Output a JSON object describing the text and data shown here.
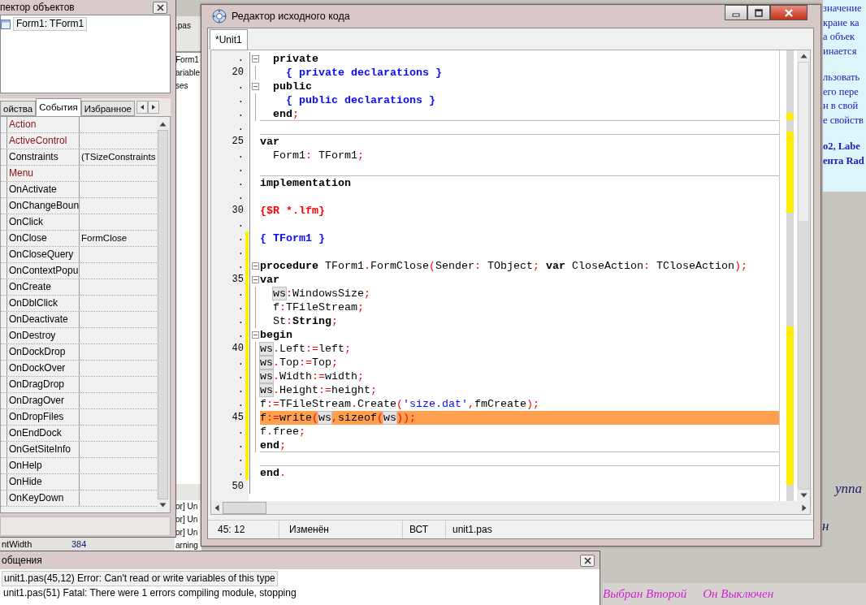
{
  "desktop": {
    "document_paragraphs": [
      {
        "bold": false,
        "lines": [
          "значение",
          "кране ка",
          "а объек",
          "инается"
        ]
      },
      {
        "bold": false,
        "lines": [
          "льзовать",
          "его пере",
          "н в свой",
          "е свойств"
        ]
      },
      {
        "bold": true,
        "lines": [
          "о2, Labe",
          "ента Rad"
        ]
      }
    ],
    "ide_fragments": [
      ".pas",
      "Form1",
      "ariable",
      "ses"
    ],
    "message_fragments": [
      "or] Un",
      "or] Un",
      "or] Un",
      "arning"
    ],
    "property_fragment": {
      "name": "ntWidth",
      "value": "384"
    },
    "group_labels": [
      "уппа",
      "н"
    ],
    "radio_status": [
      "Выбран Второй",
      "Он Выключен"
    ]
  },
  "object_inspector": {
    "title": "пектор объектов",
    "tree": [
      {
        "label": "Form1: TForm1"
      }
    ],
    "tabs": [
      {
        "label": "ойства",
        "selected": false
      },
      {
        "label": "События",
        "selected": true
      },
      {
        "label": "Избранное",
        "selected": false
      }
    ],
    "rows": [
      {
        "name": "Action",
        "kind": "reference"
      },
      {
        "name": "ActiveControl",
        "kind": "reference"
      },
      {
        "name": "Constraints",
        "value": "(TSizeConstraints",
        "kind": "plain"
      },
      {
        "name": "Menu",
        "kind": "reference"
      },
      {
        "name": "OnActivate",
        "kind": "plain"
      },
      {
        "name": "OnChangeBoun",
        "kind": "plain"
      },
      {
        "name": "OnClick",
        "kind": "plain"
      },
      {
        "name": "OnClose",
        "value": "FormClose",
        "kind": "plain"
      },
      {
        "name": "OnCloseQuery",
        "kind": "plain"
      },
      {
        "name": "OnContextPopu",
        "kind": "plain"
      },
      {
        "name": "OnCreate",
        "kind": "plain"
      },
      {
        "name": "OnDblClick",
        "kind": "plain"
      },
      {
        "name": "OnDeactivate",
        "kind": "plain"
      },
      {
        "name": "OnDestroy",
        "kind": "plain"
      },
      {
        "name": "OnDockDrop",
        "kind": "plain"
      },
      {
        "name": "OnDockOver",
        "kind": "plain"
      },
      {
        "name": "OnDragDrop",
        "kind": "plain"
      },
      {
        "name": "OnDragOver",
        "kind": "plain"
      },
      {
        "name": "OnDropFiles",
        "kind": "plain"
      },
      {
        "name": "OnEndDock",
        "kind": "plain"
      },
      {
        "name": "OnGetSiteInfo",
        "kind": "plain"
      },
      {
        "name": "OnHelp",
        "kind": "plain"
      },
      {
        "name": "OnHide",
        "kind": "plain"
      },
      {
        "name": "OnKeyDown",
        "kind": "plain"
      }
    ]
  },
  "source_editor": {
    "title": "Редактор исходного кода",
    "tabs": [
      {
        "label": "*Unit1",
        "selected": true
      }
    ],
    "lines": [
      {
        "gutter": ".",
        "fold_toggle": true,
        "indented": true,
        "modified": false,
        "error": false,
        "rule_below": false,
        "tokens": [
          {
            "kind": "kw",
            "text": "private"
          }
        ]
      },
      {
        "gutter": "20",
        "fold_toggle": false,
        "in_fold": true,
        "indented": true,
        "modified": false,
        "error": false,
        "rule_below": false,
        "tokens": [
          {
            "kind": "comment",
            "text": "  { private declarations }"
          }
        ]
      },
      {
        "gutter": ".",
        "fold_toggle": true,
        "indented": true,
        "modified": false,
        "error": false,
        "rule_below": false,
        "tokens": [
          {
            "kind": "kw",
            "text": "public"
          }
        ]
      },
      {
        "gutter": ".",
        "fold_toggle": false,
        "in_fold": true,
        "indented": true,
        "modified": false,
        "error": false,
        "rule_below": false,
        "tokens": [
          {
            "kind": "comment",
            "text": "  { public declarations }"
          }
        ]
      },
      {
        "gutter": ".",
        "fold_toggle": false,
        "in_fold": true,
        "indented": true,
        "modified": false,
        "error": false,
        "rule_below": true,
        "tokens": [
          {
            "kind": "kw",
            "text": "end"
          },
          {
            "kind": "sym",
            "text": ";"
          }
        ]
      },
      {
        "gutter": ".",
        "fold_toggle": false,
        "in_fold": false,
        "modified": false,
        "error": false,
        "rule_below": true
      },
      {
        "gutter": "25",
        "fold_toggle": false,
        "in_fold": false,
        "indented": false,
        "modified": false,
        "error": false,
        "rule_below": false,
        "tokens": [
          {
            "kind": "kw",
            "text": "var"
          }
        ]
      },
      {
        "gutter": ".",
        "fold_toggle": false,
        "in_fold": false,
        "indented": true,
        "modified": false,
        "error": false,
        "rule_below": false,
        "tokens": [
          {
            "kind": "text",
            "text": "Form1"
          },
          {
            "kind": "sym",
            "text": ":"
          },
          {
            "kind": "text",
            "text": " TForm1"
          },
          {
            "kind": "sym",
            "text": ";"
          }
        ]
      },
      {
        "gutter": ".",
        "fold_toggle": false,
        "in_fold": false,
        "modified": false,
        "error": false,
        "rule_below": true
      },
      {
        "gutter": ".",
        "fold_toggle": false,
        "in_fold": false,
        "indented": false,
        "modified": false,
        "error": false,
        "rule_below": false,
        "tokens": [
          {
            "kind": "kw",
            "text": "implementation"
          }
        ]
      },
      {
        "gutter": ".",
        "fold_toggle": false,
        "in_fold": false,
        "modified": false,
        "error": false,
        "rule_below": false
      },
      {
        "gutter": "30",
        "fold_toggle": false,
        "in_fold": false,
        "indented": false,
        "modified": false,
        "error": false,
        "rule_below": false,
        "tokens": [
          {
            "kind": "directive",
            "text": "{$R *.lfm}"
          }
        ]
      },
      {
        "gutter": ".",
        "fold_toggle": false,
        "in_fold": false,
        "modified": false,
        "error": false,
        "rule_below": false
      },
      {
        "gutter": ".",
        "fold_toggle": false,
        "in_fold": false,
        "indented": false,
        "modified": true,
        "error": false,
        "rule_below": false,
        "tokens": [
          {
            "kind": "comment",
            "text": "{ TForm1 }"
          }
        ]
      },
      {
        "gutter": ".",
        "fold_toggle": false,
        "in_fold": false,
        "modified": true,
        "error": false,
        "rule_below": false
      },
      {
        "gutter": ".",
        "fold_toggle": true,
        "indented": false,
        "modified": true,
        "error": false,
        "rule_below": false,
        "tokens": [
          {
            "kind": "kw",
            "text": "procedure"
          },
          {
            "kind": "text",
            "text": " TForm1"
          },
          {
            "kind": "sym",
            "text": "."
          },
          {
            "kind": "text",
            "text": "FormClose"
          },
          {
            "kind": "sym",
            "text": "("
          },
          {
            "kind": "text",
            "text": "Sender"
          },
          {
            "kind": "sym",
            "text": ":"
          },
          {
            "kind": "text",
            "text": " TObject"
          },
          {
            "kind": "sym",
            "text": "; "
          },
          {
            "kind": "kw",
            "text": "var"
          },
          {
            "kind": "text",
            "text": " CloseAction"
          },
          {
            "kind": "sym",
            "text": ":"
          },
          {
            "kind": "text",
            "text": " TCloseAction"
          },
          {
            "kind": "sym",
            "text": ");"
          }
        ]
      },
      {
        "gutter": "35",
        "fold_toggle": true,
        "indented": false,
        "modified": true,
        "error": false,
        "rule_below": false,
        "tokens": [
          {
            "kind": "kw",
            "text": "var"
          }
        ]
      },
      {
        "gutter": ".",
        "fold_toggle": false,
        "in_fold": true,
        "indented": true,
        "modified": true,
        "error": false,
        "rule_below": false,
        "tokens": [
          {
            "kind": "match",
            "text": "ws"
          },
          {
            "kind": "sym",
            "text": ":"
          },
          {
            "kind": "text",
            "text": "WindowsSize"
          },
          {
            "kind": "sym",
            "text": ";"
          }
        ]
      },
      {
        "gutter": ".",
        "fold_toggle": false,
        "in_fold": true,
        "indented": true,
        "modified": true,
        "error": false,
        "rule_below": false,
        "tokens": [
          {
            "kind": "text",
            "text": "f"
          },
          {
            "kind": "sym",
            "text": ":"
          },
          {
            "kind": "text",
            "text": "TFileStream"
          },
          {
            "kind": "sym",
            "text": ";"
          }
        ]
      },
      {
        "gutter": ".",
        "fold_toggle": false,
        "in_fold": true,
        "indented": true,
        "modified": true,
        "error": false,
        "rule_below": false,
        "tokens": [
          {
            "kind": "text",
            "text": "St"
          },
          {
            "kind": "sym",
            "text": ":"
          },
          {
            "kind": "kw",
            "text": "String"
          },
          {
            "kind": "sym",
            "text": ";"
          }
        ]
      },
      {
        "gutter": ".",
        "fold_toggle": true,
        "indented": false,
        "modified": true,
        "error": false,
        "rule_below": false,
        "tokens": [
          {
            "kind": "kw",
            "text": "begin"
          }
        ]
      },
      {
        "gutter": "40",
        "fold_toggle": false,
        "in_fold": true,
        "indented": false,
        "modified": true,
        "error": false,
        "rule_below": false,
        "tokens": [
          {
            "kind": "match",
            "text": "ws"
          },
          {
            "kind": "sym",
            "text": "."
          },
          {
            "kind": "text",
            "text": "Left"
          },
          {
            "kind": "sym",
            "text": ":="
          },
          {
            "kind": "text",
            "text": "left"
          },
          {
            "kind": "sym",
            "text": ";"
          }
        ]
      },
      {
        "gutter": ".",
        "fold_toggle": false,
        "in_fold": true,
        "indented": false,
        "modified": true,
        "error": false,
        "rule_below": false,
        "tokens": [
          {
            "kind": "match",
            "text": "ws"
          },
          {
            "kind": "sym",
            "text": "."
          },
          {
            "kind": "text",
            "text": "Top"
          },
          {
            "kind": "sym",
            "text": ":="
          },
          {
            "kind": "text",
            "text": "Top"
          },
          {
            "kind": "sym",
            "text": ";"
          }
        ]
      },
      {
        "gutter": ".",
        "fold_toggle": false,
        "in_fold": true,
        "indented": false,
        "modified": true,
        "error": false,
        "rule_below": false,
        "tokens": [
          {
            "kind": "match",
            "text": "ws"
          },
          {
            "kind": "sym",
            "text": "."
          },
          {
            "kind": "text",
            "text": "Width"
          },
          {
            "kind": "sym",
            "text": ":="
          },
          {
            "kind": "text",
            "text": "width"
          },
          {
            "kind": "sym",
            "text": ";"
          }
        ]
      },
      {
        "gutter": ".",
        "fold_toggle": false,
        "in_fold": true,
        "indented": false,
        "modified": true,
        "error": false,
        "rule_below": false,
        "tokens": [
          {
            "kind": "match",
            "text": "ws"
          },
          {
            "kind": "sym",
            "text": "."
          },
          {
            "kind": "text",
            "text": "Height"
          },
          {
            "kind": "sym",
            "text": ":="
          },
          {
            "kind": "text",
            "text": "height"
          },
          {
            "kind": "sym",
            "text": ";"
          }
        ]
      },
      {
        "gutter": ".",
        "fold_toggle": false,
        "in_fold": true,
        "indented": false,
        "modified": true,
        "error": false,
        "rule_below": false,
        "tokens": [
          {
            "kind": "text",
            "text": "f"
          },
          {
            "kind": "sym",
            "text": ":="
          },
          {
            "kind": "text",
            "text": "TFileStream"
          },
          {
            "kind": "sym",
            "text": "."
          },
          {
            "kind": "text",
            "text": "Create"
          },
          {
            "kind": "sym",
            "text": "("
          },
          {
            "kind": "str",
            "text": "'size.dat'"
          },
          {
            "kind": "sym",
            "text": ","
          },
          {
            "kind": "text",
            "text": "fmCreate"
          },
          {
            "kind": "sym",
            "text": ");"
          }
        ]
      },
      {
        "gutter": "45",
        "fold_toggle": false,
        "in_fold": true,
        "indented": false,
        "modified": true,
        "error": true,
        "rule_below": false,
        "tokens": [
          {
            "kind": "text",
            "text": "f"
          },
          {
            "kind": "sym",
            "text": ":="
          },
          {
            "kind": "text",
            "text": "write"
          },
          {
            "kind": "sym",
            "text": "("
          },
          {
            "kind": "match",
            "text": "ws"
          },
          {
            "kind": "sym",
            "text": ","
          },
          {
            "kind": "text",
            "text": "sizeof"
          },
          {
            "kind": "sym",
            "text": "("
          },
          {
            "kind": "match",
            "text": "ws"
          },
          {
            "kind": "sym",
            "text": "));"
          }
        ]
      },
      {
        "gutter": ".",
        "fold_toggle": false,
        "in_fold": true,
        "indented": false,
        "modified": true,
        "error": false,
        "rule_below": false,
        "tokens": [
          {
            "kind": "text",
            "text": "f"
          },
          {
            "kind": "sym",
            "text": "."
          },
          {
            "kind": "text",
            "text": "free"
          },
          {
            "kind": "sym",
            "text": ";"
          }
        ]
      },
      {
        "gutter": ".",
        "fold_toggle": false,
        "in_fold": true,
        "indented": false,
        "modified": true,
        "error": false,
        "rule_below": true,
        "tokens": [
          {
            "kind": "kw",
            "text": "end"
          },
          {
            "kind": "sym",
            "text": ";"
          }
        ]
      },
      {
        "gutter": ".",
        "fold_toggle": false,
        "in_fold": false,
        "modified": true,
        "error": false,
        "rule_below": true
      },
      {
        "gutter": ".",
        "fold_toggle": false,
        "in_fold": false,
        "indented": false,
        "modified": true,
        "error": false,
        "rule_below": false,
        "tokens": [
          {
            "kind": "kw",
            "text": "end"
          },
          {
            "kind": "sym",
            "text": "."
          }
        ]
      },
      {
        "gutter": "50",
        "fold_toggle": false,
        "in_fold": false,
        "modified": false,
        "error": false,
        "rule_below": false
      }
    ],
    "status": [
      "45: 12",
      "Изменён",
      "ВСТ",
      "unit1.pas"
    ]
  },
  "messages": {
    "title": "общения",
    "items": [
      {
        "text": "unit1.pas(45,12) Error: Can't read or write variables of this type",
        "selected": true
      },
      {
        "text": "unit1.pas(51) Fatal: There were 1 errors compiling module, stopping",
        "selected": false
      }
    ]
  }
}
